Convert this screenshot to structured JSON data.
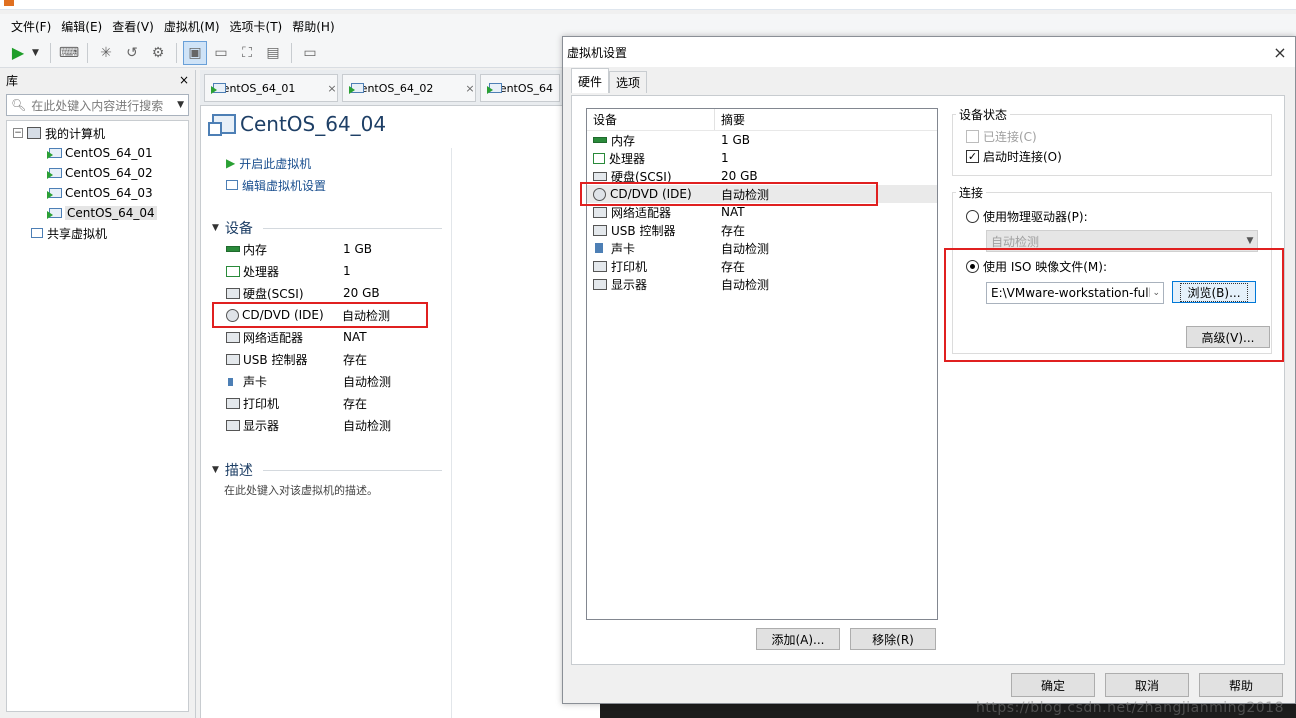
{
  "menubar": {
    "items": [
      "文件(F)",
      "编辑(E)",
      "查看(V)",
      "虚拟机(M)",
      "选项卡(T)",
      "帮助(H)"
    ]
  },
  "library": {
    "title": "库",
    "close": "×",
    "search_placeholder": "在此处键入内容进行搜索",
    "tree": {
      "root": "我的计算机",
      "vms": [
        "CentOS_64_01",
        "CentOS_64_02",
        "CentOS_64_03",
        "CentOS_64_04"
      ],
      "shared": "共享虚拟机"
    }
  },
  "tabs": [
    {
      "label": "CentOS_64_01",
      "close": "×"
    },
    {
      "label": "CentOS_64_02",
      "close": "×"
    },
    {
      "label": "CentOS_64"
    }
  ],
  "vm": {
    "title": "CentOS_64_04",
    "actions": [
      "开启此虚拟机",
      "编辑虚拟机设置"
    ],
    "devices_heading": "设备",
    "devices": [
      {
        "name": "内存",
        "value": "1 GB"
      },
      {
        "name": "处理器",
        "value": "1"
      },
      {
        "name": "硬盘(SCSI)",
        "value": "20 GB"
      },
      {
        "name": "CD/DVD (IDE)",
        "value": "自动检测"
      },
      {
        "name": "网络适配器",
        "value": "NAT"
      },
      {
        "name": "USB 控制器",
        "value": "存在"
      },
      {
        "name": "声卡",
        "value": "自动检测"
      },
      {
        "name": "打印机",
        "value": "存在"
      },
      {
        "name": "显示器",
        "value": "自动检测"
      }
    ],
    "description_heading": "描述",
    "description_text": "在此处键入对该虚拟机的描述。"
  },
  "dialog": {
    "title": "虚拟机设置",
    "close": "×",
    "tabs": [
      "硬件",
      "选项"
    ],
    "hw_header": {
      "device": "设备",
      "summary": "摘要"
    },
    "hw_rows": [
      {
        "name": "内存",
        "value": "1 GB"
      },
      {
        "name": "处理器",
        "value": "1"
      },
      {
        "name": "硬盘(SCSI)",
        "value": "20 GB"
      },
      {
        "name": "CD/DVD (IDE)",
        "value": "自动检测"
      },
      {
        "name": "网络适配器",
        "value": "NAT"
      },
      {
        "name": "USB 控制器",
        "value": "存在"
      },
      {
        "name": "声卡",
        "value": "自动检测"
      },
      {
        "name": "打印机",
        "value": "存在"
      },
      {
        "name": "显示器",
        "value": "自动检测"
      }
    ],
    "add_button": "添加(A)...",
    "remove_button": "移除(R)",
    "device_status": {
      "label": "设备状态",
      "connected": "已连接(C)",
      "connect_on_start": "启动时连接(O)"
    },
    "connection": {
      "label": "连接",
      "use_physical": "使用物理驱动器(P):",
      "physical_value": "自动检测",
      "use_iso": "使用 ISO 映像文件(M):",
      "iso_value": "E:\\VMware-workstation-full-",
      "browse": "浏览(B)...",
      "advanced": "高级(V)..."
    },
    "footer": {
      "ok": "确定",
      "cancel": "取消",
      "help": "帮助"
    }
  },
  "watermark": "https://blog.csdn.net/zhangjianming2018",
  "colors": {
    "highlight_box": "#e02020",
    "link": "#1a4f8f",
    "title": "#1e3f66"
  }
}
